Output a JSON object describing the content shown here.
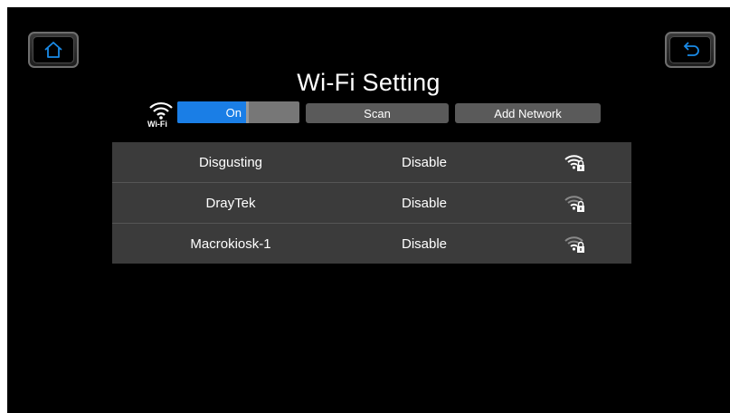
{
  "header": {
    "title": "Wi-Fi Setting"
  },
  "toolbar": {
    "wifi_badge_text": "Wi-Fi",
    "toggle_label": "On",
    "scan_label": "Scan",
    "add_network_label": "Add Network"
  },
  "networks": [
    {
      "name": "Disgusting",
      "status": "Disable",
      "signal_icon": "wifi-lock-icon",
      "signal_strength": "strong"
    },
    {
      "name": "DrayTek",
      "status": "Disable",
      "signal_icon": "wifi-lock-icon",
      "signal_strength": "weak"
    },
    {
      "name": "Macrokiosk-1",
      "status": "Disable",
      "signal_icon": "wifi-lock-icon",
      "signal_strength": "weak"
    }
  ],
  "icons": {
    "home": "home-icon",
    "back": "back-arrow-icon"
  },
  "colors": {
    "accent": "#1a7ee6",
    "background": "#000000",
    "row_background": "#3b3b3b",
    "button_background": "#5a5a5a"
  }
}
